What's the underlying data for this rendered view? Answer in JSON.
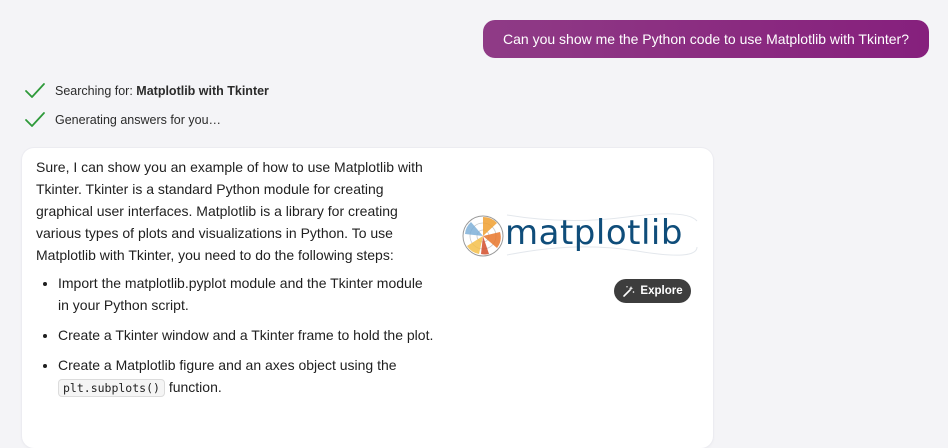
{
  "user_message": "Can you show me the Python code to use Matplotlib with Tkinter?",
  "status": {
    "searching_prefix": "Searching for: ",
    "searching_query": "Matplotlib with Tkinter",
    "generating": "Generating answers for you…"
  },
  "answer": {
    "intro": "Sure, I can show you an example of how to use Matplotlib with Tkinter. Tkinter is a standard Python module for creating graphical user interfaces. Matplotlib is a library for creating various types of plots and visualizations in Python. To use Matplotlib with Tkinter, you need to do the following steps:",
    "steps": [
      "Import the matplotlib.pyplot module and the Tkinter module in your Python script.",
      "Create a Tkinter window and a Tkinter frame to hold the plot.",
      "Create a Matplotlib figure and an axes object using the"
    ],
    "step3_code": "plt.subplots()",
    "step3_suffix": " function."
  },
  "image": {
    "logo_text": "matplotlib",
    "explore_label": "Explore"
  },
  "colors": {
    "user_bubble": "#8a2a80",
    "check": "#2e9a3a",
    "explore_bg": "#3d3d3d",
    "logo_text": "#0f4d7a"
  }
}
